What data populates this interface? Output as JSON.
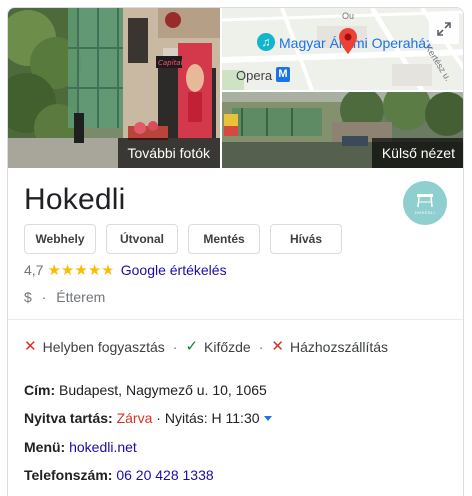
{
  "photos": {
    "more_photos_label": "További fotók",
    "street_view_label": "Külső nézet",
    "shop_sign": "Capital"
  },
  "map": {
    "opera_label": "Magyar Állami Operaház",
    "metro_label": "Opera",
    "metro_badge": "M",
    "street_label": "Kertész u.",
    "street_top": "Ou"
  },
  "place": {
    "name": "Hokedli",
    "logo_text": "HOKEDLI"
  },
  "actions": {
    "website": "Webhely",
    "directions": "Útvonal",
    "save": "Mentés",
    "call": "Hívás"
  },
  "rating": {
    "value": "4,7",
    "stars": 4.7,
    "link": "Google értékelés"
  },
  "category": {
    "price": "$",
    "sep": "·",
    "type": "Étterem"
  },
  "services": [
    {
      "label": "Helyben fogyasztás",
      "available": false
    },
    {
      "label": "Kifőzde",
      "available": true
    },
    {
      "label": "Házhozszállítás",
      "available": false
    }
  ],
  "services_sep": "·",
  "info": {
    "address_label": "Cím:",
    "address_value": "Budapest, Nagymező u. 10, 1065",
    "hours_label": "Nyitva tartás:",
    "hours_status": "Zárva",
    "hours_sep": "·",
    "hours_next": "Nyitás: H 11:30",
    "menu_label": "Menü:",
    "menu_value": "hokedli.net",
    "phone_label": "Telefonszám:",
    "phone_value": "06 20 428 1338"
  },
  "colors": {
    "link": "#1a0dab",
    "star": "#fbbc04",
    "closed": "#d93025",
    "check": "#188038",
    "logo_bg": "#8fcfcf"
  }
}
